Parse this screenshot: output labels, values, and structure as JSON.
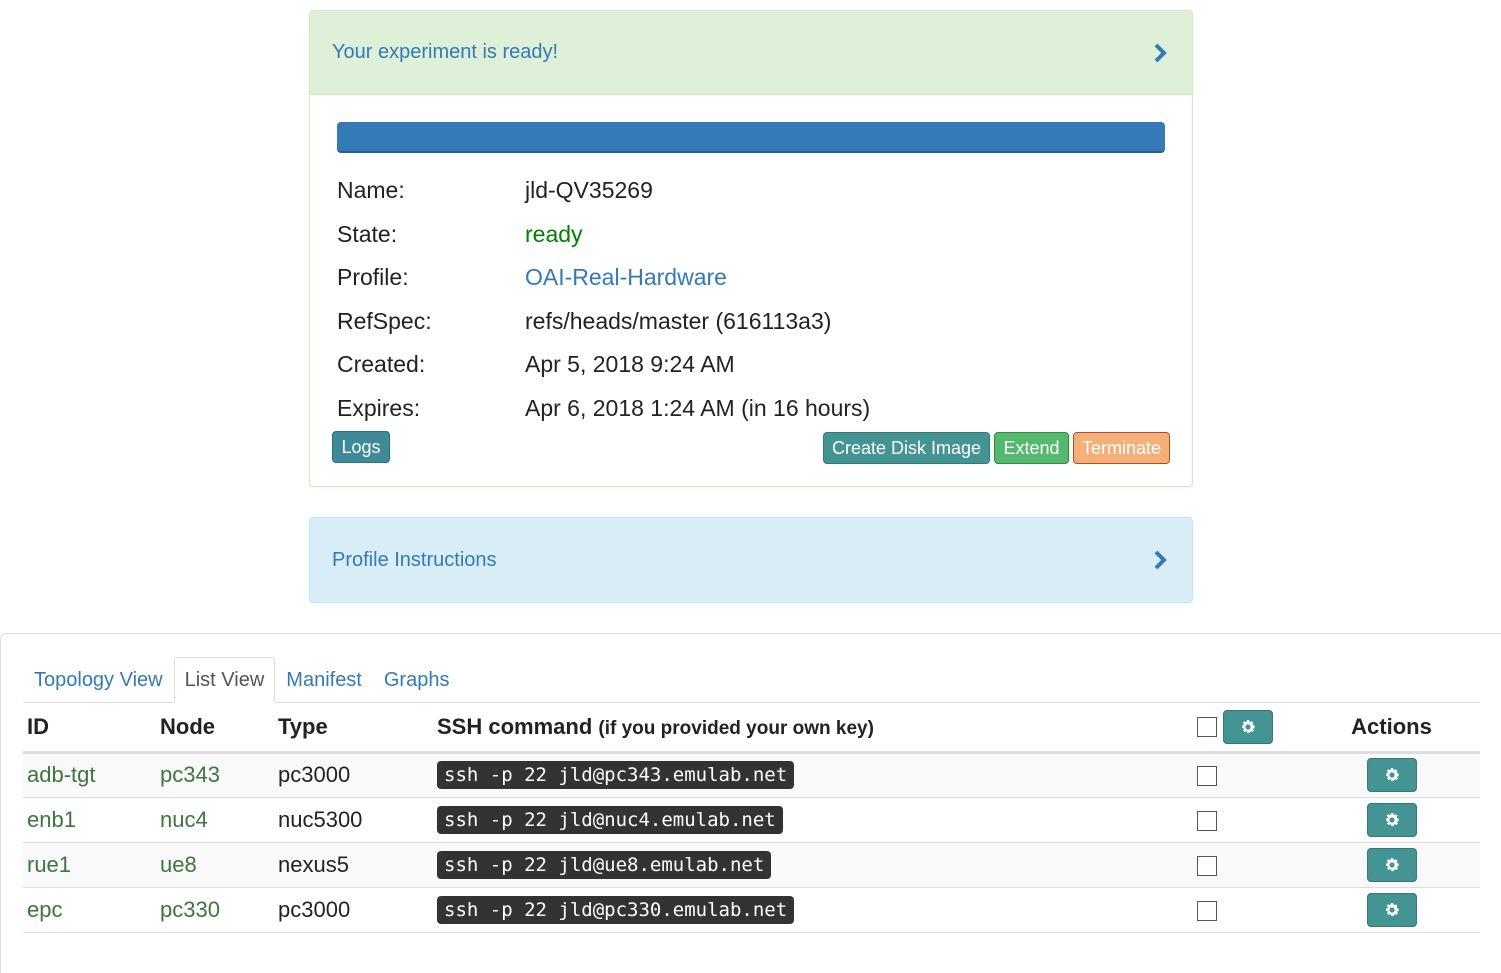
{
  "status_panel": {
    "title": "Your experiment is ready!",
    "progress_percent": 100,
    "fields": [
      {
        "label": "Name:",
        "value": "jld-QV35269",
        "style": "plain"
      },
      {
        "label": "State:",
        "value": "ready",
        "style": "ready"
      },
      {
        "label": "Profile:",
        "value": "OAI-Real-Hardware",
        "style": "link"
      },
      {
        "label": "RefSpec:",
        "value": "refs/heads/master (616113a3)",
        "style": "plain"
      },
      {
        "label": "Created:",
        "value": "Apr 5, 2018 9:24 AM",
        "style": "plain"
      },
      {
        "label": "Expires:",
        "value": "Apr 6, 2018 1:24 AM (in 16 hours)",
        "style": "plain"
      }
    ],
    "buttons": {
      "logs": "Logs",
      "create_disk_image": "Create Disk Image",
      "extend": "Extend",
      "terminate": "Terminate"
    }
  },
  "instructions_panel": {
    "title": "Profile Instructions"
  },
  "tabs": [
    {
      "label": "Topology View",
      "active": false
    },
    {
      "label": "List View",
      "active": true
    },
    {
      "label": "Manifest",
      "active": false
    },
    {
      "label": "Graphs",
      "active": false
    }
  ],
  "table": {
    "headers": {
      "id": "ID",
      "node": "Node",
      "type": "Type",
      "ssh": "SSH command",
      "ssh_note": "(if you provided your own key)",
      "actions": "Actions"
    },
    "rows": [
      {
        "id": "adb-tgt",
        "node": "pc343",
        "type": "pc3000",
        "ssh": "ssh -p 22 jld@pc343.emulab.net"
      },
      {
        "id": "enb1",
        "node": "nuc4",
        "type": "nuc5300",
        "ssh": "ssh -p 22 jld@nuc4.emulab.net"
      },
      {
        "id": "rue1",
        "node": "ue8",
        "type": "nexus5",
        "ssh": "ssh -p 22 jld@ue8.emulab.net"
      },
      {
        "id": "epc",
        "node": "pc330",
        "type": "pc3000",
        "ssh": "ssh -p 22 jld@pc330.emulab.net"
      }
    ]
  },
  "colors": {
    "link": "#337ab7",
    "success_bg": "#dff0d8",
    "info_bg": "#d9edf7",
    "ready": "#008000",
    "teal_button": "#449494"
  }
}
